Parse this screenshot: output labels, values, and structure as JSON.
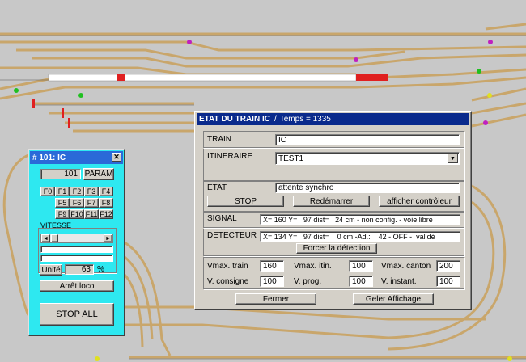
{
  "loco_panel": {
    "title": "# 101: IC",
    "close_glyph": "✕",
    "address": "101",
    "param_label": "PARAM",
    "function_keys": [
      "F0",
      "F1",
      "F2",
      "F3",
      "F4",
      "F5",
      "F6",
      "F7",
      "F8",
      "F9",
      "F10",
      "F11",
      "F12"
    ],
    "vitesse_label": "VITESSE",
    "scroll_left": "◄",
    "scroll_right": "►",
    "unit_label": "Unité",
    "speed_value": "63",
    "percent_label": "%",
    "arret_label": "Arrêt loco",
    "stop_all_label": "STOP ALL"
  },
  "etat_window": {
    "title": "ETAT DU TRAIN IC",
    "title_sep": "/",
    "title_time": "Temps = 1335",
    "train_label": "TRAIN",
    "train_value": "IC",
    "itineraire_label": "ITINERAIRE",
    "itineraire_value": "TEST1",
    "etat_label": "ETAT",
    "etat_value": "attente synchro",
    "stop_label": "STOP",
    "redemarrer_label": "Redémarrer",
    "afficher_label": "afficher contrôleur",
    "signal_label": "SIGNAL",
    "signal_value": "X= 160 Y=   97 dist=   24 cm - non config. - voie libre",
    "detecteur_label": "DETECTEUR",
    "detecteur_value": "X= 134 Y=   97 dist=    0 cm -Ad.:    42 - OFF -  validé",
    "forcer_label": "Forcer la détection",
    "vmax_train_label": "Vmax. train",
    "vmax_train_value": "160",
    "vmax_itin_label": "Vmax. itin.",
    "vmax_itin_value": "100",
    "vmax_canton_label": "Vmax. canton",
    "vmax_canton_value": "200",
    "v_consigne_label": "V. consigne",
    "v_consigne_value": "100",
    "v_prog_label": "V. prog.",
    "v_prog_value": "100",
    "v_instant_label": "V. instant.",
    "v_instant_value": "100",
    "fermer_label": "Fermer",
    "geler_label": "Geler Affichage"
  },
  "colors": {
    "background": "#c8c8c8",
    "track": "#c9a66b",
    "loco_panel": "#2ee8f0",
    "loco_titlebar": "#2a6ad8",
    "etat_titlebar": "#0a2a8c",
    "train_red": "#e02020"
  }
}
